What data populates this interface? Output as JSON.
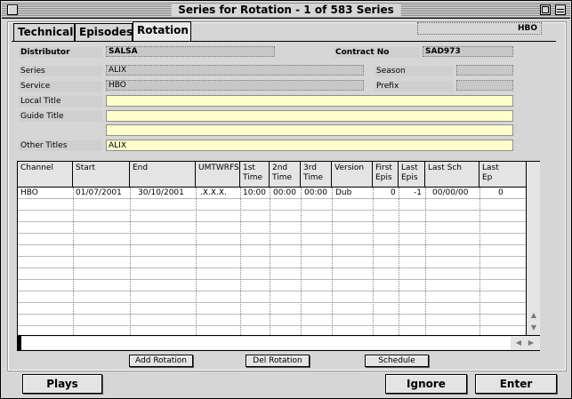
{
  "window": {
    "title": "Series for Rotation - 1 of 583 Series"
  },
  "tabs": [
    {
      "label": "Technical"
    },
    {
      "label": "Episodes"
    },
    {
      "label": "Rotation"
    }
  ],
  "header": {
    "service_badge": "HBO"
  },
  "fields": {
    "distributor": {
      "label": "Distributor",
      "value": "SALSA"
    },
    "contract_no": {
      "label": "Contract No",
      "value": "SAD973"
    },
    "series": {
      "label": "Series",
      "value": "ALIX"
    },
    "season": {
      "label": "Season",
      "value": ""
    },
    "service": {
      "label": "Service",
      "value": "HBO"
    },
    "prefix": {
      "label": "Prefix",
      "value": ""
    },
    "local_title": {
      "label": "Local Title",
      "value": ""
    },
    "guide_title": {
      "label": "Guide Title",
      "value": ""
    },
    "guide_title_2": {
      "value": ""
    },
    "other_titles": {
      "label": "Other Titles",
      "value": "ALIX"
    }
  },
  "table": {
    "headers": {
      "channel": "Channel",
      "start": "Start",
      "end": "End",
      "umtwrfs": "UMTWRFS",
      "t1a": "1st",
      "t1b": "Time",
      "t2a": "2nd",
      "t2b": "Time",
      "t3a": "3rd",
      "t3b": "Time",
      "version": "Version",
      "fea": "First",
      "feb": "Epis",
      "lea": "Last",
      "leb": "Epis",
      "lastsch": "Last Sch",
      "lepa": "Last",
      "lepb": "Ep"
    },
    "rows": [
      {
        "channel": "HBO",
        "start": "01/07/2001",
        "end": "30/10/2001",
        "umtwrfs": ".X.X.X.",
        "time1": "10:00",
        "time2": "00:00",
        "time3": "00:00",
        "version": "Dub",
        "first_epis": "0",
        "last_epis": "-1",
        "last_sch": "00/00/00",
        "last_ep": "0"
      }
    ]
  },
  "actions": {
    "add_rotation": "Add Rotation",
    "del_rotation": "Del Rotation",
    "schedule": "Schedule",
    "plays": "Plays",
    "ignore": "Ignore",
    "enter": "Enter"
  },
  "icons": {
    "close": "close-box-icon",
    "zoom": "zoom-box-icon",
    "collapse": "collapse-box-icon",
    "scroll_up": "arrow-up-icon",
    "scroll_down": "arrow-down-icon",
    "scroll_left": "arrow-left-icon",
    "scroll_right": "arrow-right-icon"
  },
  "colors": {
    "input_bg": "#ffffcc",
    "window_bg": "#d6d6d6"
  }
}
